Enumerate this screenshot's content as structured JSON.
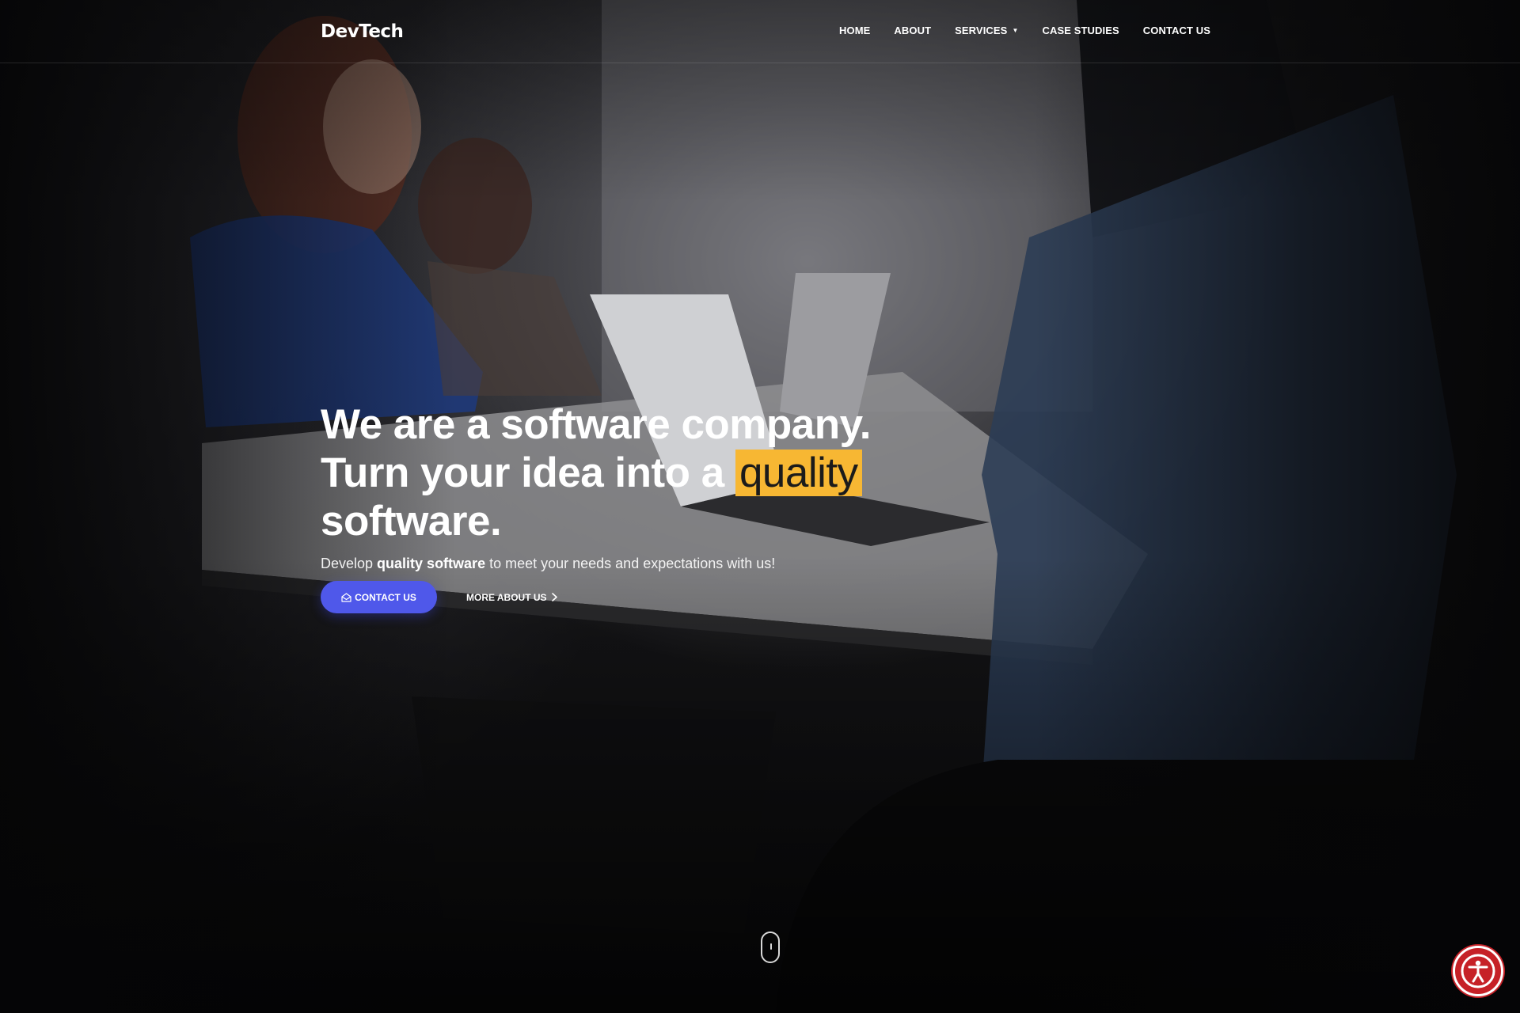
{
  "header": {
    "logo": "DevTech",
    "nav": [
      {
        "label": "HOME"
      },
      {
        "label": "ABOUT"
      },
      {
        "label": "SERVICES",
        "has_dropdown": true
      },
      {
        "label": "CASE STUDIES"
      },
      {
        "label": "CONTACT US"
      }
    ]
  },
  "hero": {
    "headline_line1": "We are a software company.",
    "headline_line2_before": "Turn your idea into a ",
    "headline_highlight": "quality",
    "headline_line3": "software.",
    "subline_before": "Develop ",
    "subline_bold": "quality software",
    "subline_after": " to meet your needs and expectations with us!",
    "primary_button": "CONTACT US",
    "secondary_button": "MORE ABOUT US"
  },
  "icons": {
    "primary_button_icon": "envelope-icon",
    "secondary_button_icon": "chevron-right-icon",
    "scroll_indicator": "mouse-scroll-icon",
    "accessibility": "accessibility-icon"
  },
  "colors": {
    "accent": "#4f58ea",
    "highlight": "#f7b733",
    "accessibility": "#c62127"
  }
}
